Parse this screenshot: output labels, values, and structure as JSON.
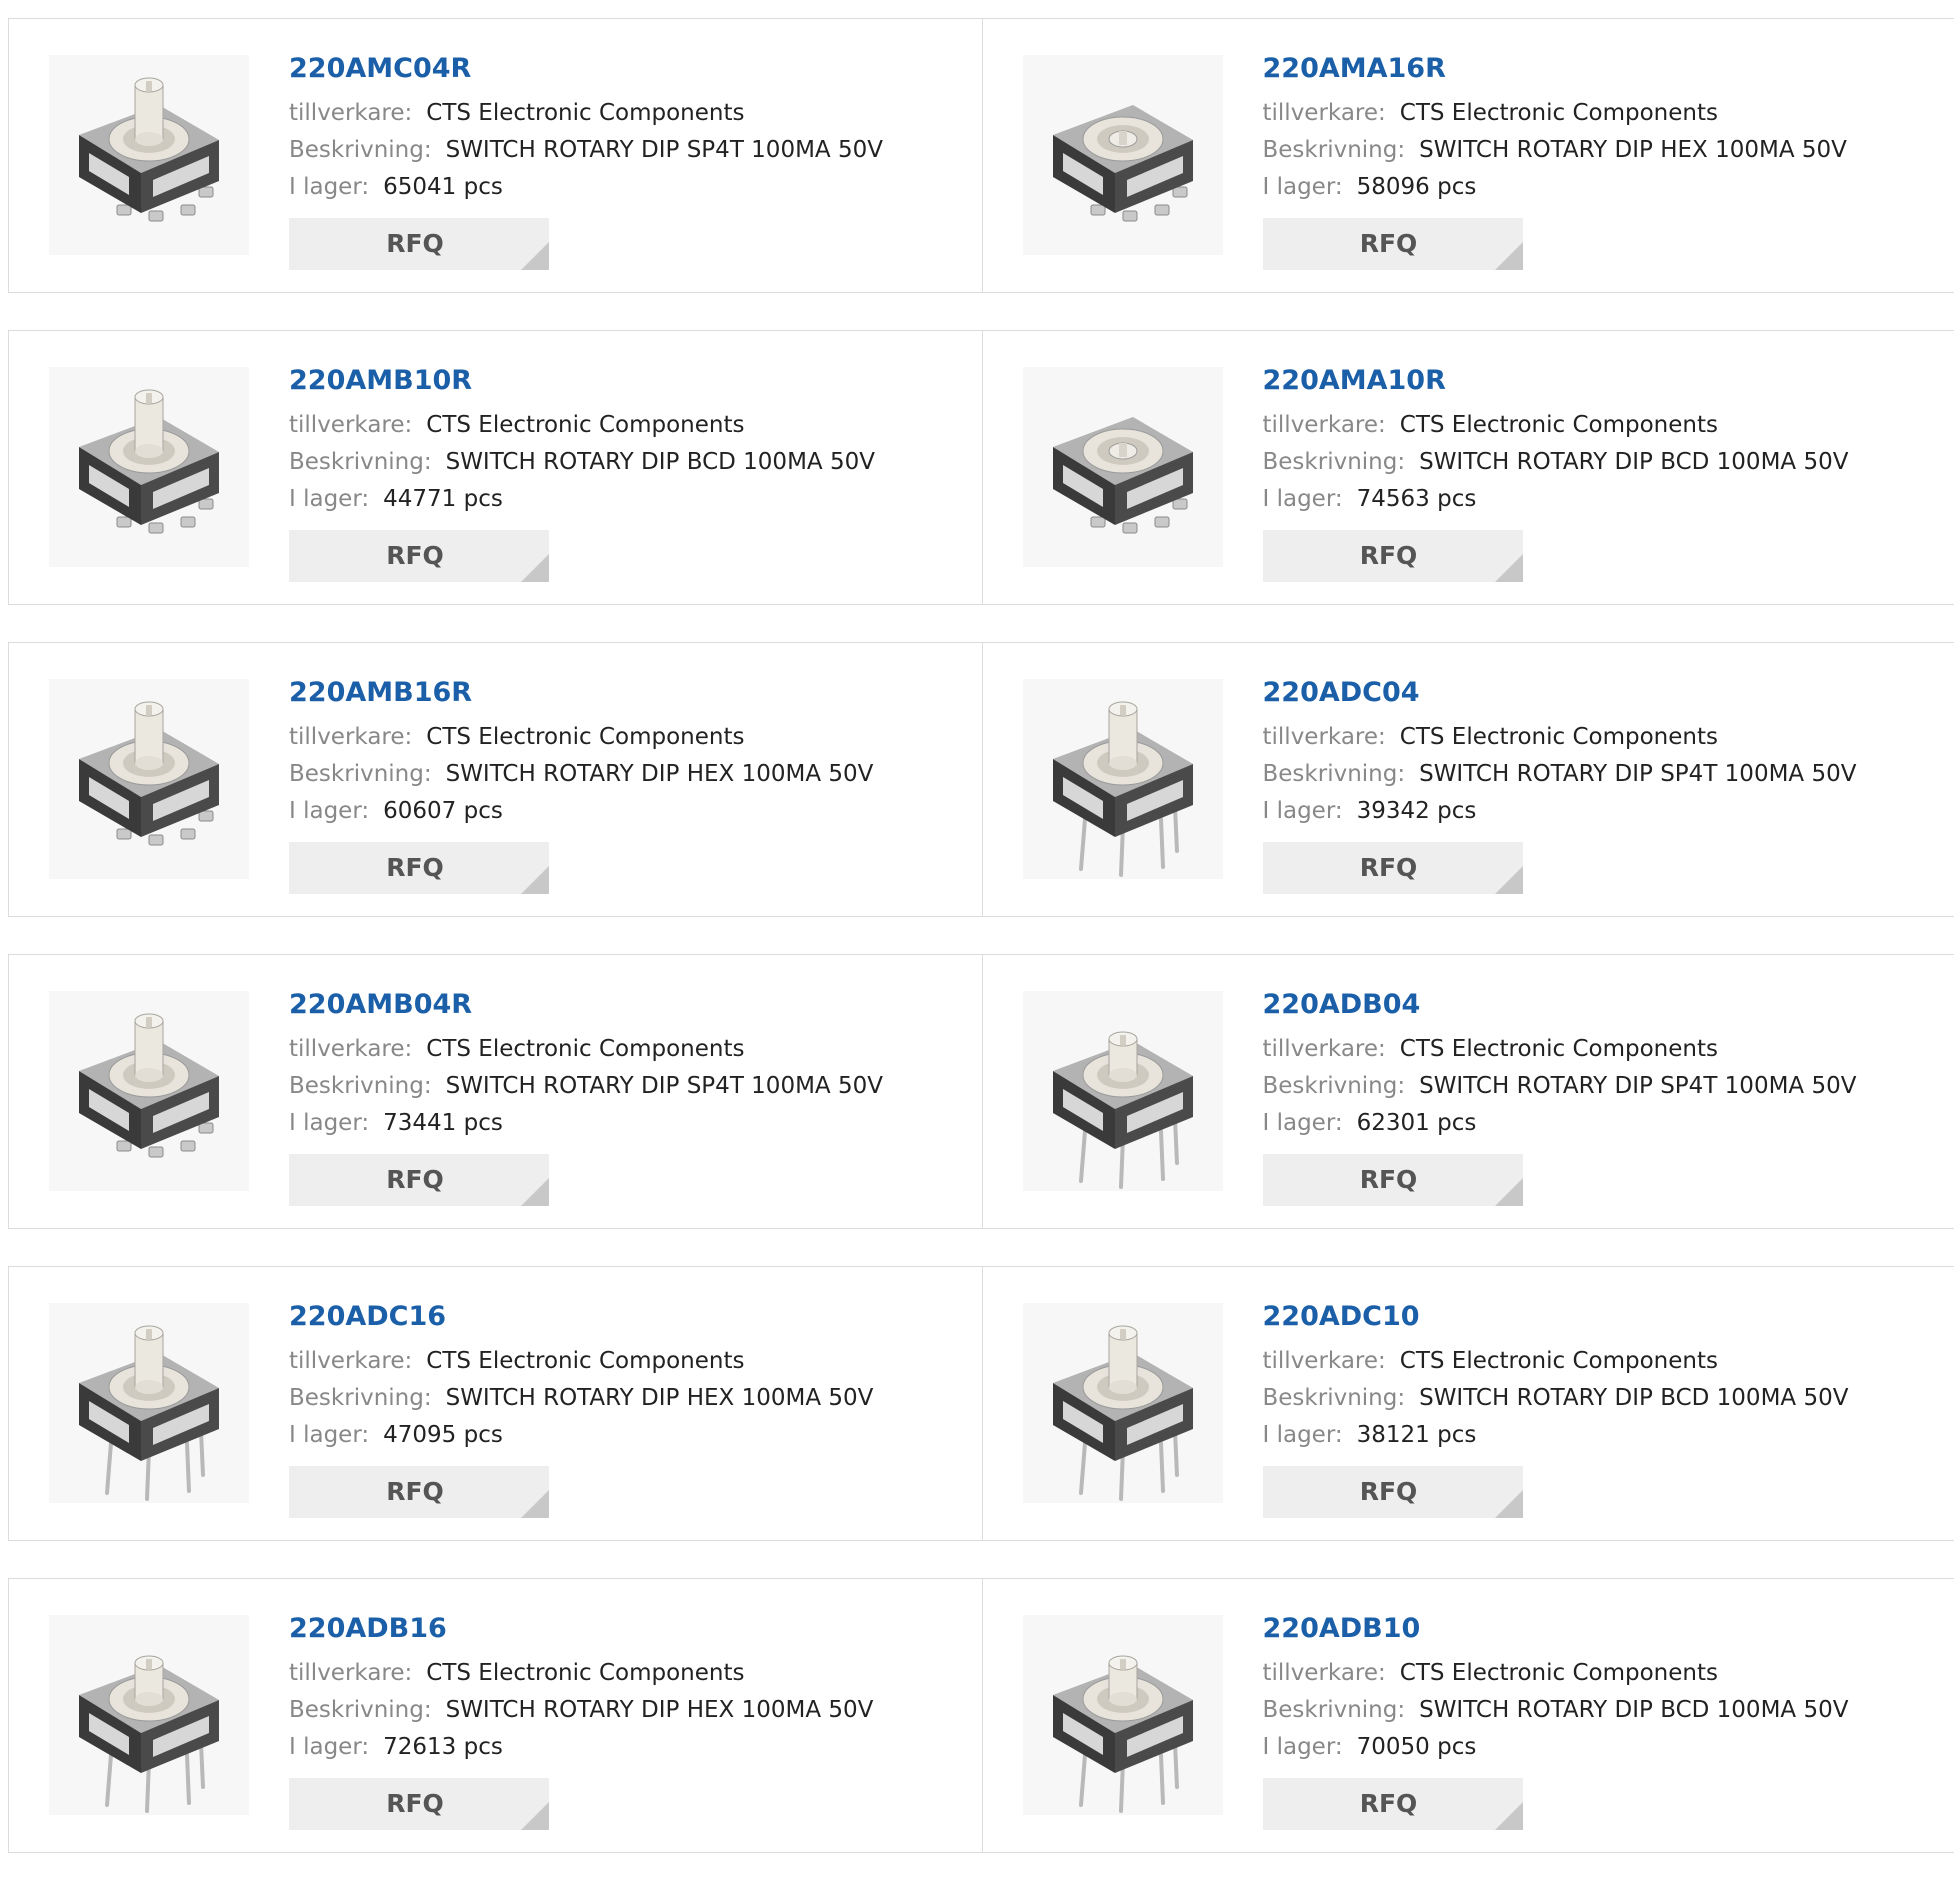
{
  "labels": {
    "manufacturer": "tillverkare:",
    "description": "Beskrivning:",
    "stock": "I lager:",
    "rfq": "RFQ"
  },
  "products": [
    {
      "part": "220AMC04R",
      "manufacturer": "CTS Electronic Components",
      "description": "SWITCH ROTARY DIP SP4T 100MA 50V",
      "stock": "65041 pcs",
      "image": "switch-smd-tall-knob"
    },
    {
      "part": "220AMA16R",
      "manufacturer": "CTS Electronic Components",
      "description": "SWITCH ROTARY DIP HEX 100MA 50V",
      "stock": "58096 pcs",
      "image": "switch-smd-flat-dial"
    },
    {
      "part": "220AMB10R",
      "manufacturer": "CTS Electronic Components",
      "description": "SWITCH ROTARY DIP BCD 100MA 50V",
      "stock": "44771 pcs",
      "image": "switch-smd-tall-knob"
    },
    {
      "part": "220AMA10R",
      "manufacturer": "CTS Electronic Components",
      "description": "SWITCH ROTARY DIP BCD 100MA 50V",
      "stock": "74563 pcs",
      "image": "switch-smd-flat-dial"
    },
    {
      "part": "220AMB16R",
      "manufacturer": "CTS Electronic Components",
      "description": "SWITCH ROTARY DIP HEX 100MA 50V",
      "stock": "60607 pcs",
      "image": "switch-smd-tall-knob"
    },
    {
      "part": "220ADC04",
      "manufacturer": "CTS Electronic Components",
      "description": "SWITCH ROTARY DIP SP4T 100MA 50V",
      "stock": "39342 pcs",
      "image": "switch-through-hole-tall-knob"
    },
    {
      "part": "220AMB04R",
      "manufacturer": "CTS Electronic Components",
      "description": "SWITCH ROTARY DIP SP4T 100MA 50V",
      "stock": "73441 pcs",
      "image": "switch-smd-tall-knob"
    },
    {
      "part": "220ADB04",
      "manufacturer": "CTS Electronic Components",
      "description": "SWITCH ROTARY DIP SP4T 100MA 50V",
      "stock": "62301 pcs",
      "image": "switch-through-hole-knob"
    },
    {
      "part": "220ADC16",
      "manufacturer": "CTS Electronic Components",
      "description": "SWITCH ROTARY DIP HEX 100MA 50V",
      "stock": "47095 pcs",
      "image": "switch-through-hole-tall-knob"
    },
    {
      "part": "220ADC10",
      "manufacturer": "CTS Electronic Components",
      "description": "SWITCH ROTARY DIP BCD 100MA 50V",
      "stock": "38121 pcs",
      "image": "switch-through-hole-tall-knob"
    },
    {
      "part": "220ADB16",
      "manufacturer": "CTS Electronic Components",
      "description": "SWITCH ROTARY DIP HEX 100MA 50V",
      "stock": "72613 pcs",
      "image": "switch-through-hole-knob"
    },
    {
      "part": "220ADB10",
      "manufacturer": "CTS Electronic Components",
      "description": "SWITCH ROTARY DIP BCD 100MA 50V",
      "stock": "70050 pcs",
      "image": "switch-through-hole-knob"
    }
  ],
  "colors": {
    "part_link": "#1a5fa8",
    "label_gray": "#888888",
    "value_text": "#222222",
    "rfq_bg": "#eeeeee",
    "rfq_text": "#555555",
    "border": "#dcdcdc"
  }
}
